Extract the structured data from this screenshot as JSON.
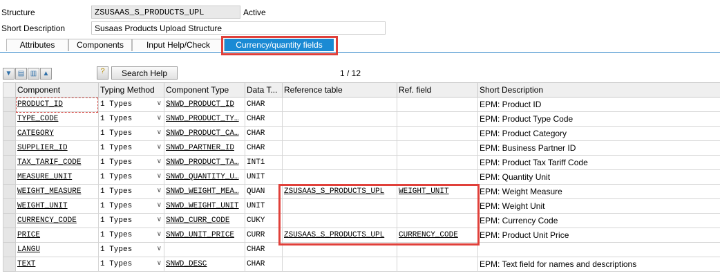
{
  "header": {
    "structure_label": "Structure",
    "structure_value": "ZSUSAAS_S_PRODUCTS_UPL",
    "status": "Active",
    "short_desc_label": "Short Description",
    "short_desc_value": "Susaas Products Upload Structure"
  },
  "tabs": [
    "Attributes",
    "Components",
    "Input Help/Check",
    "Currency/quantity fields"
  ],
  "toolbar": {
    "search_help_label": "Search Help",
    "pager": "1 / 12",
    "icons": [
      "expand-all-icon",
      "insert-row-icon",
      "delete-row-icon",
      "collapse-all-icon",
      "search-help-icon"
    ]
  },
  "grid": {
    "columns": [
      "Component",
      "Typing Method",
      "Component Type",
      "Data T...",
      "Reference table",
      "Ref. field",
      "Short Description"
    ],
    "rows": [
      {
        "component": "PRODUCT_ID",
        "typing": "1 Types",
        "type": "SNWD_PRODUCT_ID",
        "dtype": "CHAR",
        "ref_table": "",
        "ref_field": "",
        "desc": "EPM: Product ID"
      },
      {
        "component": "TYPE_CODE",
        "typing": "1 Types",
        "type": "SNWD_PRODUCT_TY…",
        "dtype": "CHAR",
        "ref_table": "",
        "ref_field": "",
        "desc": "EPM: Product Type Code"
      },
      {
        "component": "CATEGORY",
        "typing": "1 Types",
        "type": "SNWD_PRODUCT_CA…",
        "dtype": "CHAR",
        "ref_table": "",
        "ref_field": "",
        "desc": "EPM: Product Category"
      },
      {
        "component": "SUPPLIER_ID",
        "typing": "1 Types",
        "type": "SNWD_PARTNER_ID",
        "dtype": "CHAR",
        "ref_table": "",
        "ref_field": "",
        "desc": "EPM: Business Partner ID"
      },
      {
        "component": "TAX_TARIF_CODE",
        "typing": "1 Types",
        "type": "SNWD_PRODUCT_TA…",
        "dtype": "INT1",
        "ref_table": "",
        "ref_field": "",
        "desc": "EPM: Product Tax Tariff Code"
      },
      {
        "component": "MEASURE_UNIT",
        "typing": "1 Types",
        "type": "SNWD_QUANTITY_U…",
        "dtype": "UNIT",
        "ref_table": "",
        "ref_field": "",
        "desc": "EPM: Quantity Unit"
      },
      {
        "component": "WEIGHT_MEASURE",
        "typing": "1 Types",
        "type": "SNWD_WEIGHT_MEA…",
        "dtype": "QUAN",
        "ref_table": "ZSUSAAS_S_PRODUCTS_UPL",
        "ref_field": "WEIGHT_UNIT",
        "desc": "EPM: Weight Measure"
      },
      {
        "component": "WEIGHT_UNIT",
        "typing": "1 Types",
        "type": "SNWD_WEIGHT_UNIT",
        "dtype": "UNIT",
        "ref_table": "",
        "ref_field": "",
        "desc": "EPM: Weight Unit"
      },
      {
        "component": "CURRENCY_CODE",
        "typing": "1 Types",
        "type": "SNWD_CURR_CODE",
        "dtype": "CUKY",
        "ref_table": "",
        "ref_field": "",
        "desc": "EPM: Currency Code"
      },
      {
        "component": "PRICE",
        "typing": "1 Types",
        "type": "SNWD_UNIT_PRICE",
        "dtype": "CURR",
        "ref_table": "ZSUSAAS_S_PRODUCTS_UPL",
        "ref_field": "CURRENCY_CODE",
        "desc": "EPM: Product Unit Price"
      },
      {
        "component": "LANGU",
        "typing": "1 Types",
        "type": "",
        "dtype": "CHAR",
        "ref_table": "",
        "ref_field": "",
        "desc": ""
      },
      {
        "component": "TEXT",
        "typing": "1 Types",
        "type": "SNWD_DESC",
        "dtype": "CHAR",
        "ref_table": "",
        "ref_field": "",
        "desc": "EPM: Text field for names and descriptions"
      }
    ]
  }
}
